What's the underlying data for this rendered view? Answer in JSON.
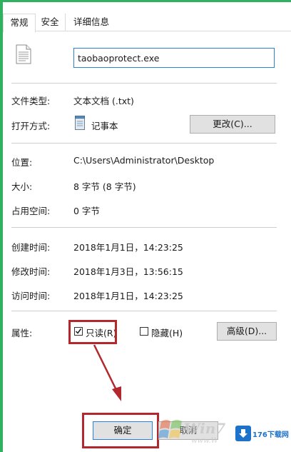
{
  "tabs": [
    {
      "label": "常规",
      "active": true
    },
    {
      "label": "安全",
      "active": false
    },
    {
      "label": "详细信息",
      "active": false
    }
  ],
  "file": {
    "name": "taobaoprotect.exe",
    "icon": "document-file-icon"
  },
  "fields": {
    "type_label": "文件类型:",
    "type_value": "文本文档 (.txt)",
    "open_with_label": "打开方式:",
    "open_with_app": "记事本",
    "change_button": "更改(C)...",
    "location_label": "位置:",
    "location_value": "C:\\Users\\Administrator\\Desktop",
    "size_label": "大小:",
    "size_value": "8 字节 (8 字节)",
    "disk_size_label": "占用空间:",
    "disk_size_value": "0 字节",
    "created_label": "创建时间:",
    "created_value": "2018年1月1日，14:23:25",
    "modified_label": "修改时间:",
    "modified_value": "2018年1月3日，13:56:15",
    "accessed_label": "访问时间:",
    "accessed_value": "2018年1月1日，14:23:25"
  },
  "attributes": {
    "label": "属性:",
    "readonly": {
      "label": "只读(R)",
      "checked": true
    },
    "hidden": {
      "label": "隐藏(H)",
      "checked": false
    },
    "advanced_button": "高级(D)..."
  },
  "footer": {
    "ok_button": "确定",
    "cancel_button": "取消"
  },
  "watermark": {
    "text": "Win7",
    "url_fragment": "www.W",
    "logo_text": "176下载网"
  },
  "colors": {
    "frame": "#2fb15f",
    "highlight": "#b3282d",
    "input_border": "#2a7fd6"
  }
}
